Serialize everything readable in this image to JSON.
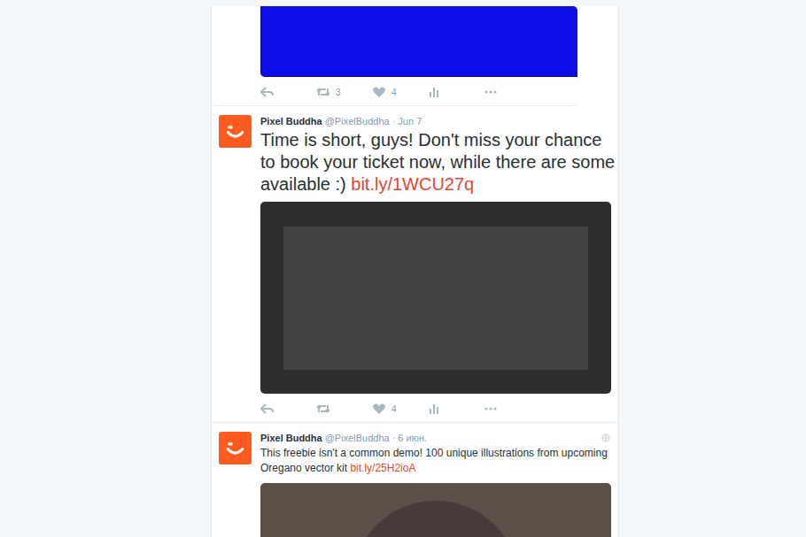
{
  "tweets": [
    {
      "kind": "media",
      "media": "blue",
      "actions": [
        {
          "kind": "reply"
        },
        {
          "kind": "retweet",
          "count": "3"
        },
        {
          "kind": "like",
          "count": "4"
        },
        {
          "kind": "analytics"
        },
        {
          "kind": "more"
        }
      ]
    },
    {
      "kind": "large",
      "author": "Pixel Buddha",
      "handle": "@PixelBuddha",
      "time": "· Jun 7",
      "globe": false,
      "text": "Time is short, guys! Don't miss your chance to book your ticket now, while there are some available :)",
      "link": "bit.ly/1WCU27q",
      "media": "quote",
      "actions": [
        {
          "kind": "reply"
        },
        {
          "kind": "retweet"
        },
        {
          "kind": "like",
          "count": "4"
        },
        {
          "kind": "analytics"
        },
        {
          "kind": "more"
        }
      ]
    },
    {
      "kind": "compact",
      "author": "Pixel Buddha",
      "handle": "@PixelBuddha",
      "time": "· 6 июн.",
      "globe": true,
      "text": "This freebie isn't a common demo! 100 unique illustrations from upcoming Oregano vector kit",
      "link": "bit.ly/25H2ioA",
      "media": "kit",
      "actions": []
    }
  ]
}
